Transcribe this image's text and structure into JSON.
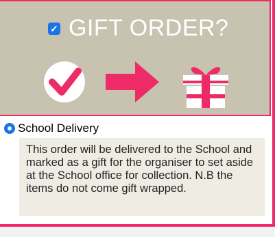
{
  "gift": {
    "title": "GIFT ORDER?",
    "checked": true
  },
  "delivery": {
    "option_label": "School Delivery",
    "selected": true,
    "description": "This order will be delivered to the School and marked as a gift for the organiser to set aside at the School office for collection. N.B the items do not come gift wrapped."
  },
  "colors": {
    "accent": "#ee2b66",
    "banner_bg": "#c8c2b0",
    "control_blue": "#1a73e8",
    "note_bg": "#eeece3"
  },
  "icons": [
    "checkmark-circle-icon",
    "arrow-right-icon",
    "gift-box-icon"
  ]
}
